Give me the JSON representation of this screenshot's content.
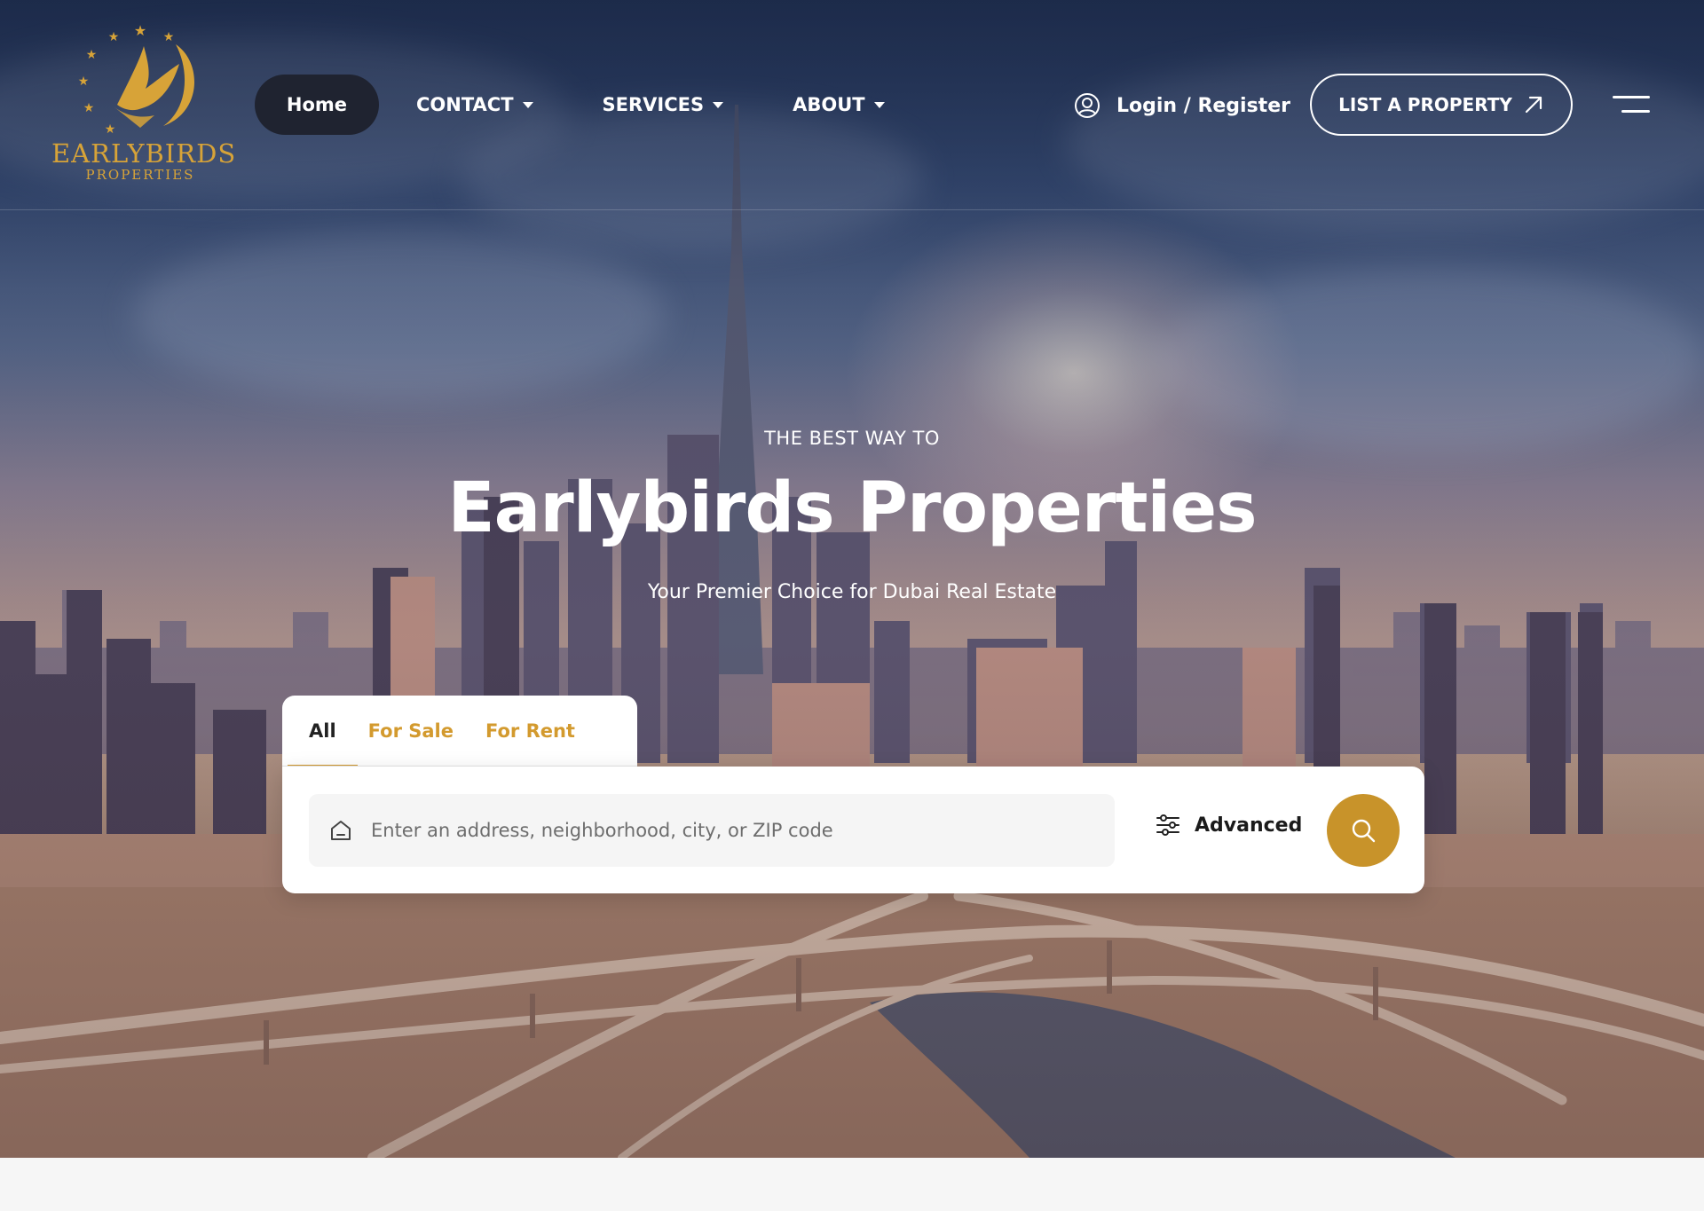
{
  "brand": {
    "name": "EARLYBIRDS",
    "sub": "PROPERTIES",
    "gold": "#d7a338"
  },
  "nav": {
    "home": "Home",
    "contact": "CONTACT",
    "services": "SERVICES",
    "about": "ABOUT"
  },
  "account": {
    "login": "Login / Register",
    "icon": "user-circle-icon"
  },
  "cta": {
    "list_property": "LIST A PROPERTY",
    "icon": "arrow-up-right-icon"
  },
  "hero": {
    "eyebrow": "THE BEST WAY TO",
    "title": "Earlybirds Properties",
    "subtitle": "Your Premier Choice for Dubai Real Estate"
  },
  "search": {
    "tabs": [
      "All",
      "For Sale",
      "For Rent"
    ],
    "active_tab": "All",
    "placeholder": "Enter an address, neighborhood, city, or ZIP code",
    "advanced": "Advanced",
    "accent": "#c8932a"
  }
}
